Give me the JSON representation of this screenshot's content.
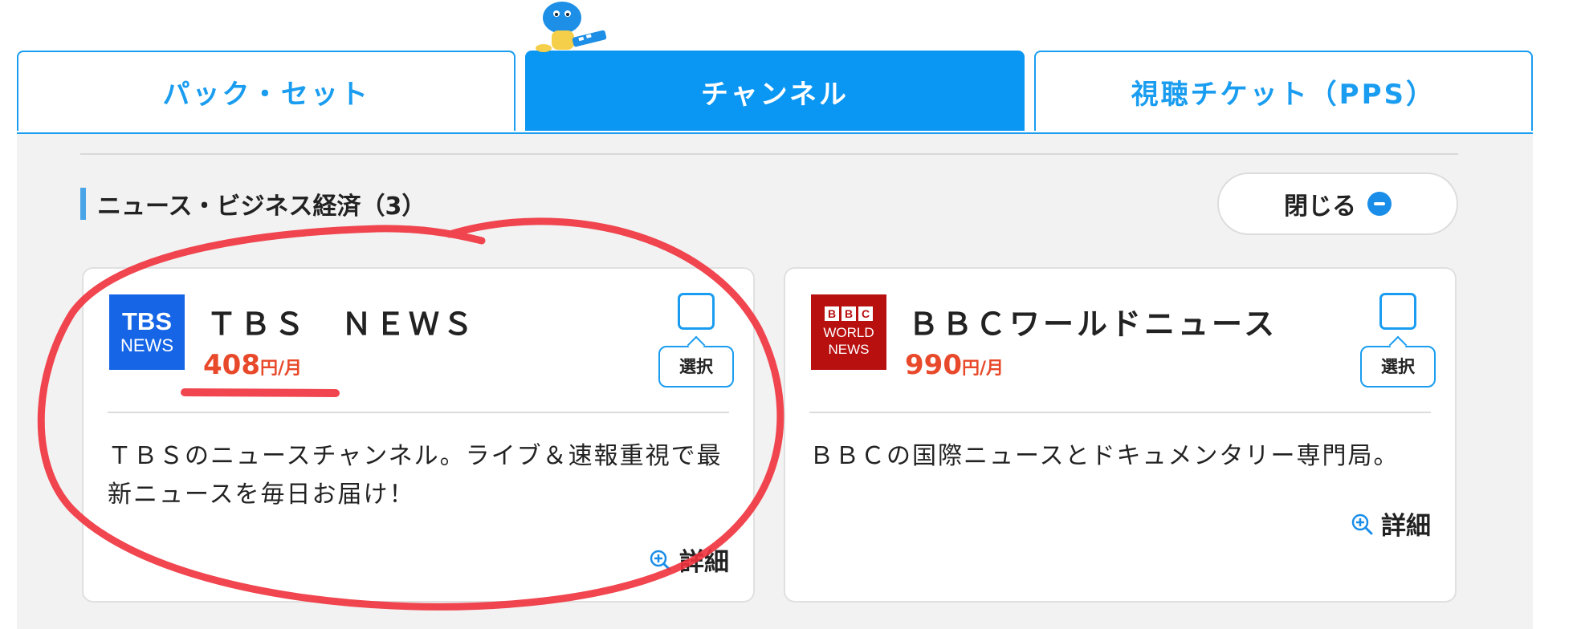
{
  "tabs": [
    {
      "label": "パック・セット",
      "active": false
    },
    {
      "label": "チャンネル",
      "active": true
    },
    {
      "label": "視聴チケット（PPS）",
      "active": false
    }
  ],
  "section": {
    "title": "ニュース・ビジネス経済（3）",
    "close_label": "閉じる"
  },
  "channels": [
    {
      "logo_line1": "TBS",
      "logo_line2": "NEWS",
      "name": "ＴＢＳ　ＮＥＷＳ",
      "price": "408",
      "price_unit": "円/月",
      "select_label": "選択",
      "description": "ＴＢＳのニュースチャンネル。ライブ＆速報重視で最新ニュースを毎日お届け！",
      "detail_label": "詳細"
    },
    {
      "logo_boxes": [
        "B",
        "B",
        "C"
      ],
      "logo_line1": "WORLD",
      "logo_line2": "NEWS",
      "name": "ＢＢＣワールドニュース",
      "price": "990",
      "price_unit": "円/月",
      "select_label": "選択",
      "description": "ＢＢＣの国際ニュースとドキュメンタリー専門局。",
      "detail_label": "詳細"
    }
  ],
  "colors": {
    "accent": "#0a96f3",
    "price": "#e8492a",
    "annotation": "#f0323c",
    "tbs_logo": "#1565e6",
    "bbc_logo": "#b80f0f"
  }
}
